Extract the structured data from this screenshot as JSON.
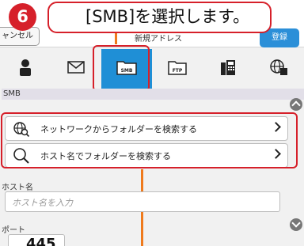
{
  "callout": {
    "step": "6",
    "text": "[SMB]を選択します。"
  },
  "topbar": {
    "cancel_label": "ャンセル",
    "title": "新規アドレス",
    "register_label": "登録"
  },
  "tabs": [
    {
      "icon": "person-icon",
      "selected": false
    },
    {
      "icon": "envelope-icon",
      "selected": false
    },
    {
      "icon": "smb-folder-icon",
      "label": "SMB",
      "selected": true
    },
    {
      "icon": "ftp-folder-icon",
      "label": "FTP",
      "selected": false
    },
    {
      "icon": "fax-icon",
      "selected": false
    },
    {
      "icon": "globe-icon",
      "selected": false
    }
  ],
  "section": {
    "label": "SMB"
  },
  "search": {
    "network_label": "ネットワークからフォルダーを検索する",
    "hostname_label": "ホスト名でフォルダーを検索する"
  },
  "host": {
    "label": "ホスト名",
    "placeholder": "ホスト名を入力"
  },
  "port": {
    "label": "ポート",
    "value": "445"
  },
  "colors": {
    "accent": "#1f8fd6",
    "highlight": "#d6202a",
    "connector": "#ef7a1c"
  }
}
